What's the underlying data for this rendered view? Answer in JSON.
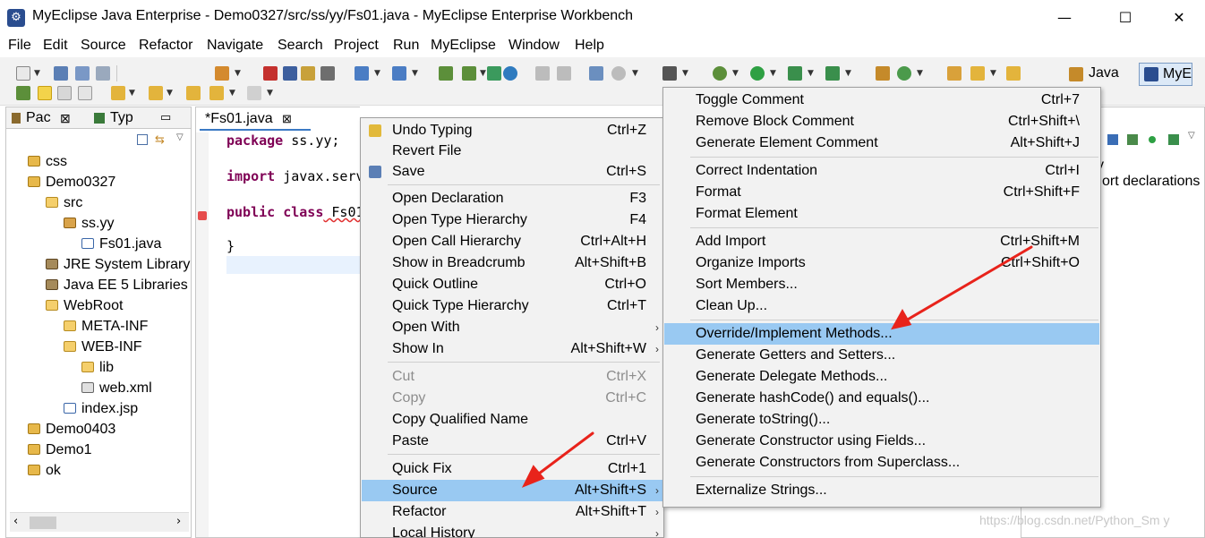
{
  "window": {
    "title": "MyEclipse Java Enterprise - Demo0327/src/ss/yy/Fs01.java - MyEclipse Enterprise Workbench",
    "minimize": "—",
    "maximize": "☐",
    "close": "✕"
  },
  "menubar": [
    "File",
    "Edit",
    "Source",
    "Refactor",
    "Navigate",
    "Search",
    "Project",
    "Run",
    "MyEclipse",
    "Window",
    "Help"
  ],
  "perspectives": {
    "java": "Java",
    "myeclipse": "MyE"
  },
  "explorer": {
    "tabs": [
      "Pac",
      "Typ"
    ],
    "tree": [
      "css",
      "Demo0327",
      "src",
      "ss.yy",
      "Fs01.java",
      "JRE System Library",
      "Java EE 5 Libraries",
      "WebRoot",
      "META-INF",
      "WEB-INF",
      "lib",
      "web.xml",
      "index.jsp",
      "Demo0403",
      "Demo1",
      "ok"
    ]
  },
  "editor": {
    "tab_label": "*Fs01.java",
    "line1_kw": "package",
    "line1_rest": " ss.yy;",
    "line2_kw": "import",
    "line2_rest": " javax.serv",
    "line3_kw": "public class",
    "line3_rest": " Fs01",
    "line4": "}"
  },
  "rightview": {
    "partial_text": "ort declarations",
    "partial_y": "y"
  },
  "context_menu": {
    "items": [
      {
        "label": "Undo Typing",
        "accel": "Ctrl+Z"
      },
      {
        "label": "Revert File",
        "accel": ""
      },
      {
        "label": "Save",
        "accel": "Ctrl+S"
      },
      {
        "label": "Open Declaration",
        "accel": "F3"
      },
      {
        "label": "Open Type Hierarchy",
        "accel": "F4"
      },
      {
        "label": "Open Call Hierarchy",
        "accel": "Ctrl+Alt+H"
      },
      {
        "label": "Show in Breadcrumb",
        "accel": "Alt+Shift+B"
      },
      {
        "label": "Quick Outline",
        "accel": "Ctrl+O"
      },
      {
        "label": "Quick Type Hierarchy",
        "accel": "Ctrl+T"
      },
      {
        "label": "Open With",
        "accel": ""
      },
      {
        "label": "Show In",
        "accel": "Alt+Shift+W"
      },
      {
        "label": "Cut",
        "accel": "Ctrl+X"
      },
      {
        "label": "Copy",
        "accel": "Ctrl+C"
      },
      {
        "label": "Copy Qualified Name",
        "accel": ""
      },
      {
        "label": "Paste",
        "accel": "Ctrl+V"
      },
      {
        "label": "Quick Fix",
        "accel": "Ctrl+1"
      },
      {
        "label": "Source",
        "accel": "Alt+Shift+S"
      },
      {
        "label": "Refactor",
        "accel": "Alt+Shift+T"
      },
      {
        "label": "Local History",
        "accel": ""
      }
    ]
  },
  "source_submenu": {
    "items": [
      {
        "label": "Toggle Comment",
        "accel": "Ctrl+7"
      },
      {
        "label": "Remove Block Comment",
        "accel": "Ctrl+Shift+\\"
      },
      {
        "label": "Generate Element Comment",
        "accel": "Alt+Shift+J"
      },
      {
        "label": "Correct Indentation",
        "accel": "Ctrl+I"
      },
      {
        "label": "Format",
        "accel": "Ctrl+Shift+F"
      },
      {
        "label": "Format Element",
        "accel": ""
      },
      {
        "label": "Add Import",
        "accel": "Ctrl+Shift+M"
      },
      {
        "label": "Organize Imports",
        "accel": "Ctrl+Shift+O"
      },
      {
        "label": "Sort Members...",
        "accel": ""
      },
      {
        "label": "Clean Up...",
        "accel": ""
      },
      {
        "label": "Override/Implement Methods...",
        "accel": ""
      },
      {
        "label": "Generate Getters and Setters...",
        "accel": ""
      },
      {
        "label": "Generate Delegate Methods...",
        "accel": ""
      },
      {
        "label": "Generate hashCode() and equals()...",
        "accel": ""
      },
      {
        "label": "Generate toString()...",
        "accel": ""
      },
      {
        "label": "Generate Constructor using Fields...",
        "accel": ""
      },
      {
        "label": "Generate Constructors from Superclass...",
        "accel": ""
      },
      {
        "label": "Externalize Strings...",
        "accel": ""
      }
    ]
  },
  "watermark": "https://blog.csdn.net/Python_Sm y",
  "colors": {
    "highlight": "#99c9f2",
    "keyword": "#7f0055",
    "arrow": "#e8231b"
  }
}
